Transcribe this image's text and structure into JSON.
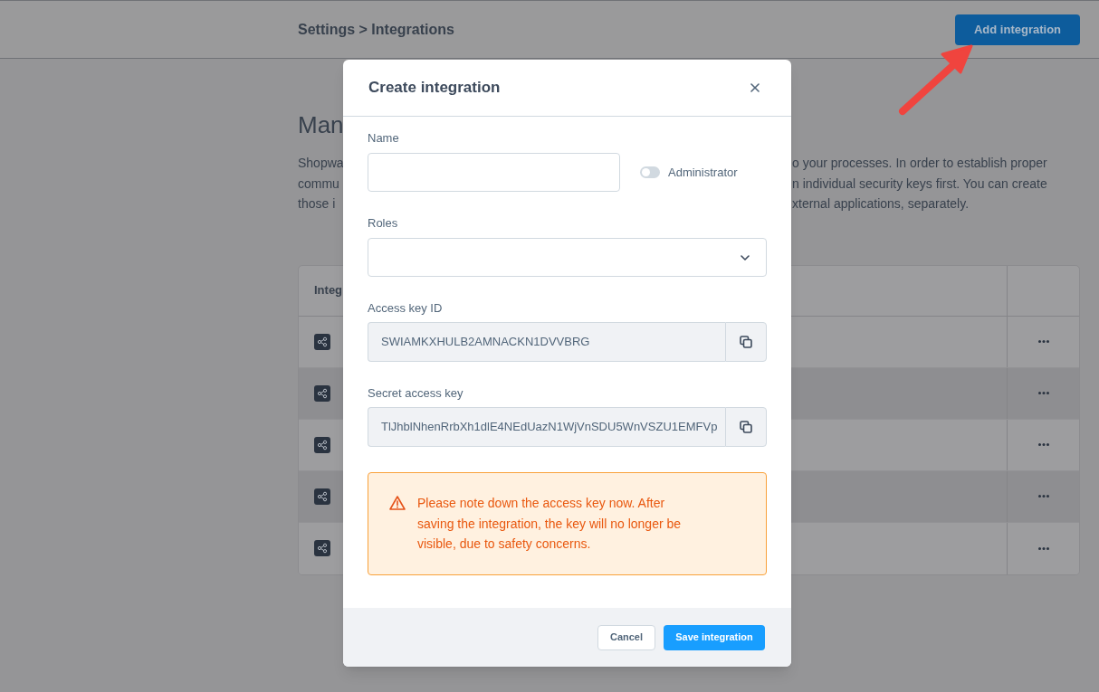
{
  "header": {
    "breadcrumb": "Settings > Integrations",
    "button": "Add integration"
  },
  "page": {
    "heading": "Man",
    "description_left": [
      "Shopwa",
      "commu",
      "those i"
    ],
    "description_right": [
      "o your processes. In order to establish proper",
      "n individual security keys first. You can create",
      "xternal applications, separately."
    ]
  },
  "table": {
    "columns": [
      "Integ"
    ],
    "rows": [
      {
        "shaded": false
      },
      {
        "shaded": true
      },
      {
        "shaded": false
      },
      {
        "shaded": true
      },
      {
        "shaded": false
      }
    ]
  },
  "modal": {
    "title": "Create integration",
    "name_field": {
      "label": "Name"
    },
    "admin_toggle": {
      "label": "Administrator",
      "on": false
    },
    "roles_field": {
      "label": "Roles"
    },
    "key_fields": [
      {
        "label": "Access key ID",
        "value": "SWIAMKXHULB2AMNACKN1DVVBRG",
        "disabled": true
      },
      {
        "label": "Secret access key",
        "value": "TlJhblNhenRrbXh1dlE4NEdUazN1WjVnSDU5WnVSZU1EMFVp",
        "disabled": true
      }
    ],
    "warning": "Please note down the access key now. After saving the integration, the key will no longer be visible, due to safety concerns.",
    "buttons": [
      {
        "label": "Cancel",
        "kind": "secondary"
      },
      {
        "label": "Save integration",
        "kind": "primary"
      }
    ]
  }
}
